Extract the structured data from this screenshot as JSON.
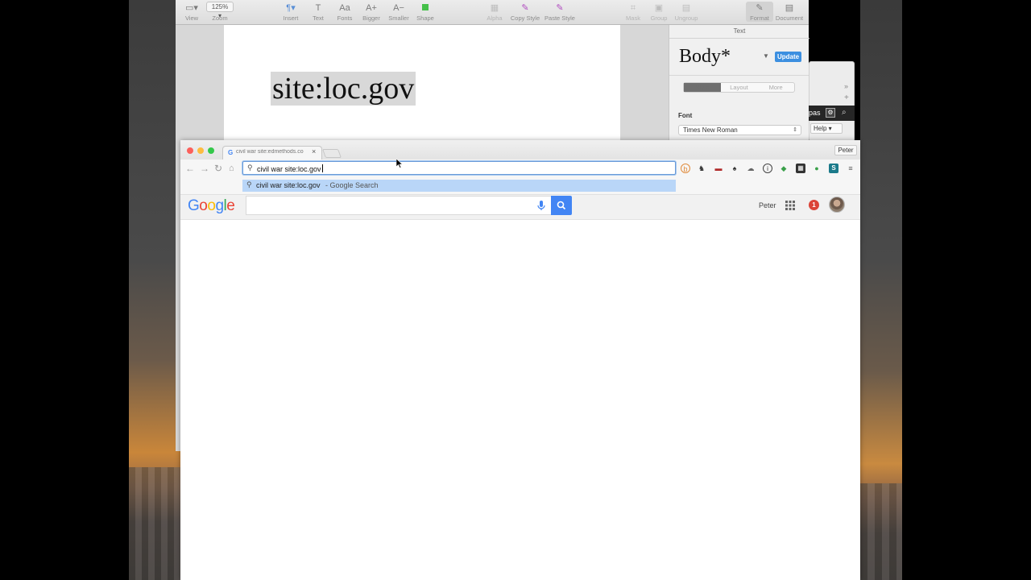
{
  "pages": {
    "toolbar": {
      "view_label": "View",
      "zoom_value": "125%",
      "zoom_label": "Zoom",
      "insert_label": "Insert",
      "text_label": "Text",
      "fonts_label": "Fonts",
      "bigger_label": "Bigger",
      "smaller_label": "Smaller",
      "shape_label": "Shape",
      "alpha_label": "Alpha",
      "copy_style_label": "Copy Style",
      "paste_style_label": "Paste Style",
      "mask_label": "Mask",
      "group_label": "Group",
      "ungroup_label": "Ungroup",
      "format_label": "Format",
      "document_label": "Document",
      "fonts_icon": "Aa",
      "bigger_icon": "A+",
      "smaller_icon": "A−"
    },
    "document_text": "site:loc.gov",
    "inspector": {
      "title": "Text",
      "style_name": "Body*",
      "update_label": "Update",
      "tabs": [
        "Style",
        "Layout",
        "More"
      ],
      "font_label": "Font",
      "font_value": "Times New Roman"
    },
    "help": {
      "search_text": "pas",
      "help_label": "Help"
    }
  },
  "chrome": {
    "tab_title": "civil war site:edmethods.co",
    "profile_name": "Peter",
    "omnibox_text": "civil war site:loc.gov",
    "suggestion": {
      "query": "civil war site:loc.gov",
      "description": "- Google Search"
    }
  },
  "google": {
    "logo_letters": [
      "G",
      "o",
      "o",
      "g",
      "l",
      "e"
    ],
    "user_name": "Peter",
    "notification_count": "1"
  },
  "colors": {
    "google_blue": "#4285f4",
    "google_red": "#ea4335",
    "google_yellow": "#fbbc05",
    "google_green": "#34a853",
    "update_button": "#3c8fe0",
    "suggestion_highlight": "#b9d6f8"
  }
}
